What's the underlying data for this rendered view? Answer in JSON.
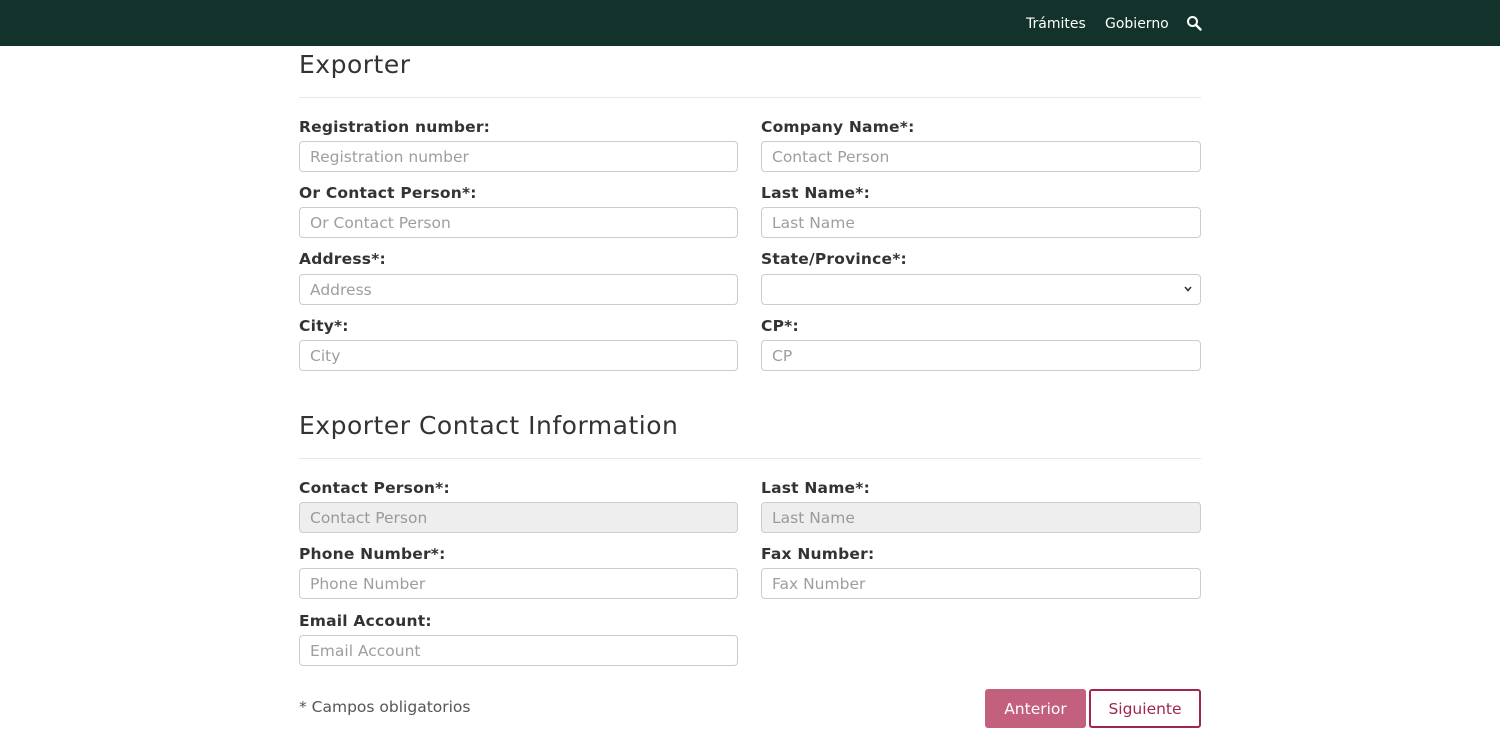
{
  "nav": {
    "links": [
      "Trámites",
      "Gobierno"
    ],
    "search_icon": "search-icon"
  },
  "exporter": {
    "title": "Exporter",
    "fields": {
      "registration": {
        "label": "Registration number:",
        "placeholder": "Registration number",
        "value": ""
      },
      "company": {
        "label": "Company Name*:",
        "placeholder": "Contact Person",
        "value": ""
      },
      "or_contact": {
        "label": "Or Contact Person*:",
        "placeholder": "Or Contact Person",
        "value": ""
      },
      "last_name": {
        "label": "Last Name*:",
        "placeholder": "Last Name",
        "value": ""
      },
      "address": {
        "label": "Address*:",
        "placeholder": "Address",
        "value": ""
      },
      "state": {
        "label": "State/Province*:",
        "selected": ""
      },
      "city": {
        "label": "City*:",
        "placeholder": "City",
        "value": ""
      },
      "cp": {
        "label": "CP*:",
        "placeholder": "CP",
        "value": ""
      }
    }
  },
  "contact": {
    "title": "Exporter Contact Information",
    "fields": {
      "contact_person": {
        "label": "Contact Person*:",
        "placeholder": "Contact Person",
        "value": ""
      },
      "last_name": {
        "label": "Last Name*:",
        "placeholder": "Last Name",
        "value": ""
      },
      "phone": {
        "label": "Phone Number*:",
        "placeholder": "Phone Number",
        "value": ""
      },
      "fax": {
        "label": "Fax Number:",
        "placeholder": "Fax Number",
        "value": ""
      },
      "email": {
        "label": "Email Account:",
        "placeholder": "Email Account",
        "value": ""
      }
    }
  },
  "footer": {
    "required_note": "* Campos obligatorios",
    "prev_label": "Anterior",
    "next_label": "Siguiente"
  },
  "colors": {
    "navbar": "#13322b",
    "primary_button": "#c2607e",
    "secondary_border": "#a1264d"
  }
}
